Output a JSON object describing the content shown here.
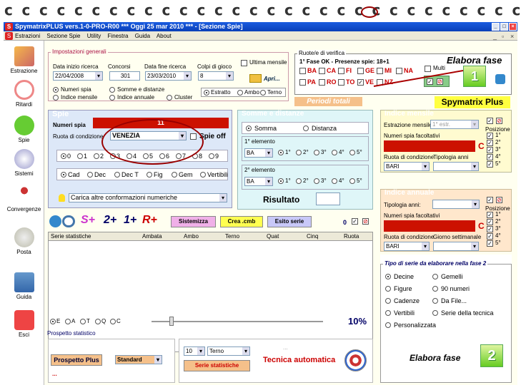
{
  "window": {
    "title": "SpymatrixPLUS vers.1-0-PRO-R00  ***  Oggi 25 mar 2010  ***  - [Sezione Spie]"
  },
  "menu": [
    "Estrazioni",
    "Sezione Spie",
    "Utility",
    "Finestra",
    "Guida",
    "About"
  ],
  "sidebar": [
    "Estrazione",
    "Ritardi",
    "Spie",
    "Sistemi",
    "Convergenze",
    "Posta",
    "Guida",
    "Esci"
  ],
  "impostazioni": {
    "title": "Impostazioni generali",
    "data_inizio_label": "Data inizio ricerca",
    "data_inizio": "22/04/2008",
    "concorsi_label": "Concorsi",
    "concorsi": "301",
    "data_fine_label": "Data fine ricerca",
    "data_fine": "23/03/2010",
    "colpi_label": "Colpi di gioco",
    "colpi": "8",
    "ultima_mensile": "Ultima mensile",
    "apri": "Apri...",
    "numeri_spia": "Numeri spia",
    "somme_distanze": "Somme e distanze",
    "indice_mensile": "Indice mensile",
    "indice_annuale": "Indice annuale",
    "cluster": "Cluster",
    "estratto": "Estratto",
    "ambo": "Ambo",
    "terno": "Terno"
  },
  "ruote": {
    "title": "Ruote/e di verifica",
    "fase_text": "1° Fase OK - Presenze spie: 18+1",
    "row1": [
      "BA",
      "CA",
      "FI",
      "GE",
      "MI",
      "NA"
    ],
    "row2": [
      "PA",
      "RO",
      "TO",
      "VE",
      "NZ"
    ],
    "multi": "Multi",
    "elabora_fase": "Elabora fase",
    "step": "1",
    "periodi_totali": "Periodi totali",
    "spymatrix_plus": "Spymatrix Plus"
  },
  "spie": {
    "title": "Spie",
    "numeri_spia_label": "Numeri spia",
    "numeri_spia_value": "11",
    "ruota_label": "Ruota di condizione",
    "ruota_value": "VENEZIA",
    "spie_off": "Spie off",
    "digits": [
      "0",
      "1",
      "2",
      "3",
      "4",
      "5",
      "6",
      "7",
      "8",
      "9"
    ],
    "modes": [
      "Cad",
      "Dec",
      "Dec T",
      "Fig",
      "Gem",
      "Vertibili"
    ],
    "carica": "Carica altre conformazioni numeriche"
  },
  "somme": {
    "title": "Somme e distanze",
    "somma": "Somma",
    "distanza": "Distanza",
    "el1": "1° elemento",
    "el2": "2° elemento",
    "ruota1": "BA",
    "ruota2": "BA",
    "positions": [
      "1°",
      "2°",
      "3°",
      "4°",
      "5°"
    ],
    "risultato": "Risultato"
  },
  "indice_mensile": {
    "title": "Indice mensile",
    "estrazione_label": "Estrazione mensile:",
    "estrazione_placeholder": "1° estr.",
    "numeri_label": "Numeri spia facoltativi",
    "ruota_label": "Ruota di condizione",
    "ruota": "BARI",
    "tipologia_label": "Tipologia anni",
    "posizione": "Posizione",
    "positions": [
      "1°",
      "2°",
      "3°",
      "4°",
      "5°"
    ],
    "c": "C"
  },
  "indice_annuale": {
    "title": "Indice annuale",
    "tipologia_label": "Tipologia anni:",
    "numeri_label": "Numeri spia facoltativi",
    "ruota_label": "Ruota di condizione",
    "ruota": "BARI",
    "giorno_label": "Giorno settimanale",
    "posizione": "Posizione",
    "positions": [
      "1°",
      "2°",
      "3°",
      "4°",
      "5°"
    ],
    "c": "C"
  },
  "toolbar": {
    "splus": "S+",
    "two": "2+",
    "one": "1+",
    "rplus": "R+",
    "sistemizza": "Sistemizza",
    "crea": "Crea .cmb",
    "esito": "Esito serie",
    "zero": "0"
  },
  "table": {
    "headers": [
      "Serie statistiche",
      "Ambata",
      "Ambo",
      "Terno",
      "Quat",
      "Cinq",
      "Ruota"
    ]
  },
  "bottom": {
    "radios": [
      "E",
      "A",
      "T",
      "Q",
      "C"
    ],
    "percent": "10%",
    "prospetto": "Prospetto statistico",
    "prospetto_plus": "Prospetto Plus",
    "standard": "Standard",
    "dots1": "...",
    "colpi": "10",
    "terno": "Terno",
    "dots2": "...",
    "serie_stat": "Serie statistiche",
    "tecnica": "Tecnica automatica"
  },
  "tipo_serie": {
    "title": "Tipo di serie da elaborare nella fase 2",
    "left": [
      "Decine",
      "Figure",
      "Cadenze",
      "Vertibili",
      "Personalizzata"
    ],
    "right": [
      "Gemelli",
      "90 numeri",
      "Da File...",
      "Serie della tecnica"
    ],
    "elabora": "Elabora fase",
    "step": "2"
  }
}
